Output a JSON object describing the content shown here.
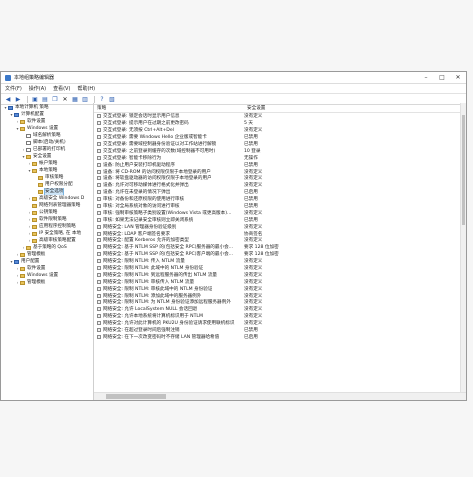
{
  "window": {
    "title": "本地组策略编辑器"
  },
  "menu": [
    "文件(F)",
    "操作(A)",
    "查看(V)",
    "帮助(H)"
  ],
  "tree": [
    {
      "label": "本地计算机 策略",
      "level": 0,
      "exp": "▾",
      "icon": "root"
    },
    {
      "label": "计算机配置",
      "level": 1,
      "exp": "▾",
      "icon": "root"
    },
    {
      "label": "软件设置",
      "level": 2,
      "exp": "›",
      "icon": "folder"
    },
    {
      "label": "Windows 设置",
      "level": 2,
      "exp": "▾",
      "icon": "folder"
    },
    {
      "label": "域名解析策略",
      "level": 3,
      "exp": "",
      "icon": "doc"
    },
    {
      "label": "脚本(启动/关机)",
      "level": 3,
      "exp": "",
      "icon": "doc"
    },
    {
      "label": "已部署的打印机",
      "level": 3,
      "exp": "›",
      "icon": "doc"
    },
    {
      "label": "安全设置",
      "level": 3,
      "exp": "▾",
      "icon": "folder"
    },
    {
      "label": "帐户策略",
      "level": 4,
      "exp": "›",
      "icon": "folder"
    },
    {
      "label": "本地策略",
      "level": 4,
      "exp": "▾",
      "icon": "folder"
    },
    {
      "label": "审核策略",
      "level": 5,
      "exp": "",
      "icon": "folder"
    },
    {
      "label": "用户权限分配",
      "level": 5,
      "exp": "",
      "icon": "folder"
    },
    {
      "label": "安全选项",
      "level": 5,
      "exp": "",
      "icon": "folder",
      "selected": true
    },
    {
      "label": "高级安全 Windows D",
      "level": 4,
      "exp": "›",
      "icon": "folder"
    },
    {
      "label": "网络列表管理器策略",
      "level": 4,
      "exp": "",
      "icon": "folder"
    },
    {
      "label": "公钥策略",
      "level": 4,
      "exp": "›",
      "icon": "folder"
    },
    {
      "label": "软件限制策略",
      "level": 4,
      "exp": "›",
      "icon": "folder"
    },
    {
      "label": "应用程序控制策略",
      "level": 4,
      "exp": "›",
      "icon": "folder"
    },
    {
      "label": "IP 安全策略, 在 本地",
      "level": 4,
      "exp": "›",
      "icon": "folder"
    },
    {
      "label": "高级审核策略配置",
      "level": 4,
      "exp": "›",
      "icon": "folder"
    },
    {
      "label": "基于策略的 QoS",
      "level": 3,
      "exp": "›",
      "icon": "folder"
    },
    {
      "label": "管理模板",
      "level": 2,
      "exp": "›",
      "icon": "folder"
    },
    {
      "label": "用户配置",
      "level": 1,
      "exp": "▾",
      "icon": "root"
    },
    {
      "label": "软件设置",
      "level": 2,
      "exp": "›",
      "icon": "folder"
    },
    {
      "label": "Windows 设置",
      "level": 2,
      "exp": "›",
      "icon": "folder"
    },
    {
      "label": "管理模板",
      "level": 2,
      "exp": "›",
      "icon": "folder"
    }
  ],
  "list": {
    "columns": [
      "策略",
      "安全设置"
    ],
    "rows": [
      [
        "交互式登录: 锁定会话时显示用户信息",
        "没有定义"
      ],
      [
        "交互式登录: 提示用户在过期之前更改密码",
        "5 天"
      ],
      [
        "交互式登录: 无须按 Ctrl+Alt+Del",
        "没有定义"
      ],
      [
        "交互式登录: 需要 Windows Hello 企业版或智能卡",
        "已禁用"
      ],
      [
        "交互式登录: 需要域控制器身份验证以对工作站进行解锁",
        "已禁用"
      ],
      [
        "交互式登录: 之前登录到缓存的次数(域控制器不可用时)",
        "10 登录"
      ],
      [
        "交互式登录: 智能卡移除行为",
        "无操作"
      ],
      [
        "设备: 防止用户安装打印机驱动程序",
        "已禁用"
      ],
      [
        "设备: 将 CD-ROM 的访问权限仅限于本地登录的用户",
        "没有定义"
      ],
      [
        "设备: 将软盘驱动器的访问权限仅限于本地登录的用户",
        "没有定义"
      ],
      [
        "设备: 允许对可移动媒体进行格式化并弹出",
        "没有定义"
      ],
      [
        "设备: 允许在未登录的情况下弹出",
        "已启用"
      ],
      [
        "审核: 对备份和还原权限的使用进行审核",
        "已禁用"
      ],
      [
        "审核: 对全局系统对象的访问进行审核",
        "已禁用"
      ],
      [
        "审核: 强制审核策略子类别设置(Windows Vista 或更高版本)...",
        "没有定义"
      ],
      [
        "审核: 如果无法记录安全审核则立即关闭系统",
        "已禁用"
      ],
      [
        "网络安全: LAN 管理器身份验证级别",
        "没有定义"
      ],
      [
        "网络安全: LDAP 客户端签名要求",
        "协商签名"
      ],
      [
        "网络安全: 配置 Kerberos 允许的加密类型",
        "没有定义"
      ],
      [
        "网络安全: 基于 NTLM SSP 的(包括安全 RPC)服务器的最小会...",
        "要求 128 位加密"
      ],
      [
        "网络安全: 基于 NTLM SSP 的(包括安全 RPC)客户端的最小会...",
        "要求 128 位加密"
      ],
      [
        "网络安全: 限制 NTLM: 传入 NTLM 流量",
        "没有定义"
      ],
      [
        "网络安全: 限制 NTLM: 此域中的 NTLM 身份验证",
        "没有定义"
      ],
      [
        "网络安全: 限制 NTLM: 到远程服务器的传出 NTLM 流量",
        "没有定义"
      ],
      [
        "网络安全: 限制 NTLM: 审核传入 NTLM 流量",
        "没有定义"
      ],
      [
        "网络安全: 限制 NTLM: 审核此域中的 NTLM 身份验证",
        "没有定义"
      ],
      [
        "网络安全: 限制 NTLM: 添加此域中的服务器例外",
        "没有定义"
      ],
      [
        "网络安全: 限制 NTLM: 为 NTLM 身份验证添加远程服务器例外",
        "没有定义"
      ],
      [
        "网络安全: 允许 LocalSystem NULL 会话回退",
        "没有定义"
      ],
      [
        "网络安全: 允许本地系统将计算机标识用于 NTLM",
        "没有定义"
      ],
      [
        "网络安全: 允许对此计算机的 PKU2U 身份验证请求使用联机标识",
        "没有定义"
      ],
      [
        "网络安全: 在超过登录时间后强制注销",
        "已禁用"
      ],
      [
        "网络安全: 在下一次改变密码时不存储 LAN 管理器哈希值",
        "已启用"
      ]
    ]
  }
}
